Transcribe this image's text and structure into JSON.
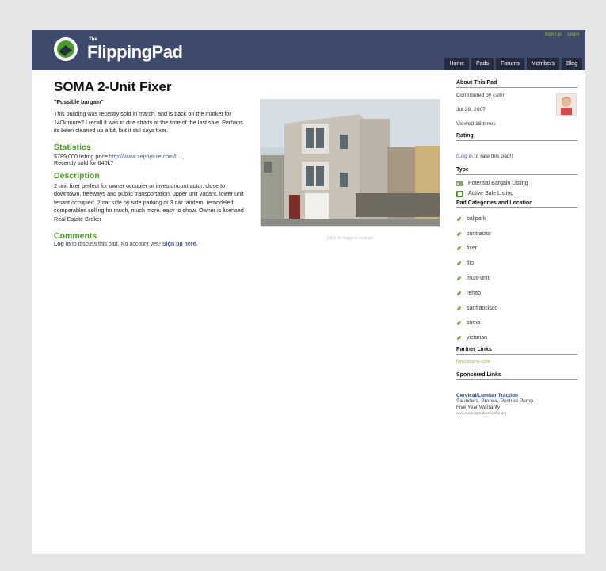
{
  "header": {
    "logo_small": "The",
    "logo_text": "FlippingPad",
    "auth": [
      "Sign Up",
      "Login"
    ],
    "nav": [
      "Home",
      "Pads",
      "Forums",
      "Members",
      "Blog"
    ]
  },
  "main": {
    "title": "SOMA 2-Unit Fixer",
    "tagline": "\"Possible bargain\"",
    "intro": "This building was recently sold in march, and is back on the market for 140k more? I recall it was in dire straits at the time of the last sale. Perhaps its been cleaned up a bit, but it still says fixer.",
    "statistics": {
      "heading": "Statistics",
      "line1_prefix": "$789,000 listing price ",
      "line1_link": "http://www.zephyr-re.com/l... ,",
      "line2": "Recently sold for 640k?"
    },
    "description": {
      "heading": "Description",
      "text": "2 unit fixer perfect for owner occupier or investor/contractor. close to downtown, freeways and public transportation. upper unit vacant, lower unit tenant occupied. 2 car side by side parking or 3 car tandem. remodeled comparables selling for much, much more. easy to show. Owner is licensed Real Estate Broker"
    },
    "photo_caption": "(click on image to enlarge)",
    "comments": {
      "heading": "Comments",
      "login": "Log in",
      "text_mid": " to discuss this pad. No account yet? ",
      "signup": "Sign up here."
    }
  },
  "sidebar": {
    "about": {
      "heading": "About This Pad",
      "contributed_prefix": "Contributed by ",
      "contributor": "calfm",
      "date": "Jul 28, 2007",
      "views": "Viewed 18 times"
    },
    "rating": {
      "heading": "Rating",
      "login": "(Log in",
      "text": " to rate this pad!)"
    },
    "type": {
      "heading": "Type",
      "items": [
        "Potential Bargain Listing",
        "Active Sale Listing"
      ]
    },
    "categories": {
      "heading": "Pad Categories and Location",
      "items": [
        "ballpark",
        "contractor",
        "fixer",
        "flip",
        "multi-unit",
        "rehab",
        "sanfrancisco",
        "soma",
        "victorian"
      ]
    },
    "partner": {
      "heading": "Partner Links",
      "logo": "foreclosure.com"
    },
    "sponsored": {
      "heading": "Sponsored Links",
      "ad_title": "Cervical/Lumbar Traction",
      "ad_line1": "Saunders, Pronex, Posture Pump",
      "ad_line2": "Five Year Warranty",
      "ad_url": "www.medicalproductsonline.org"
    }
  },
  "colors": {
    "header_bg": "#3e4a6b",
    "nav_tab_bg": "#252b3d",
    "heading_green": "#4b9a2c",
    "link_blue": "#3a5a9a",
    "auth_green": "#9bc53d"
  }
}
